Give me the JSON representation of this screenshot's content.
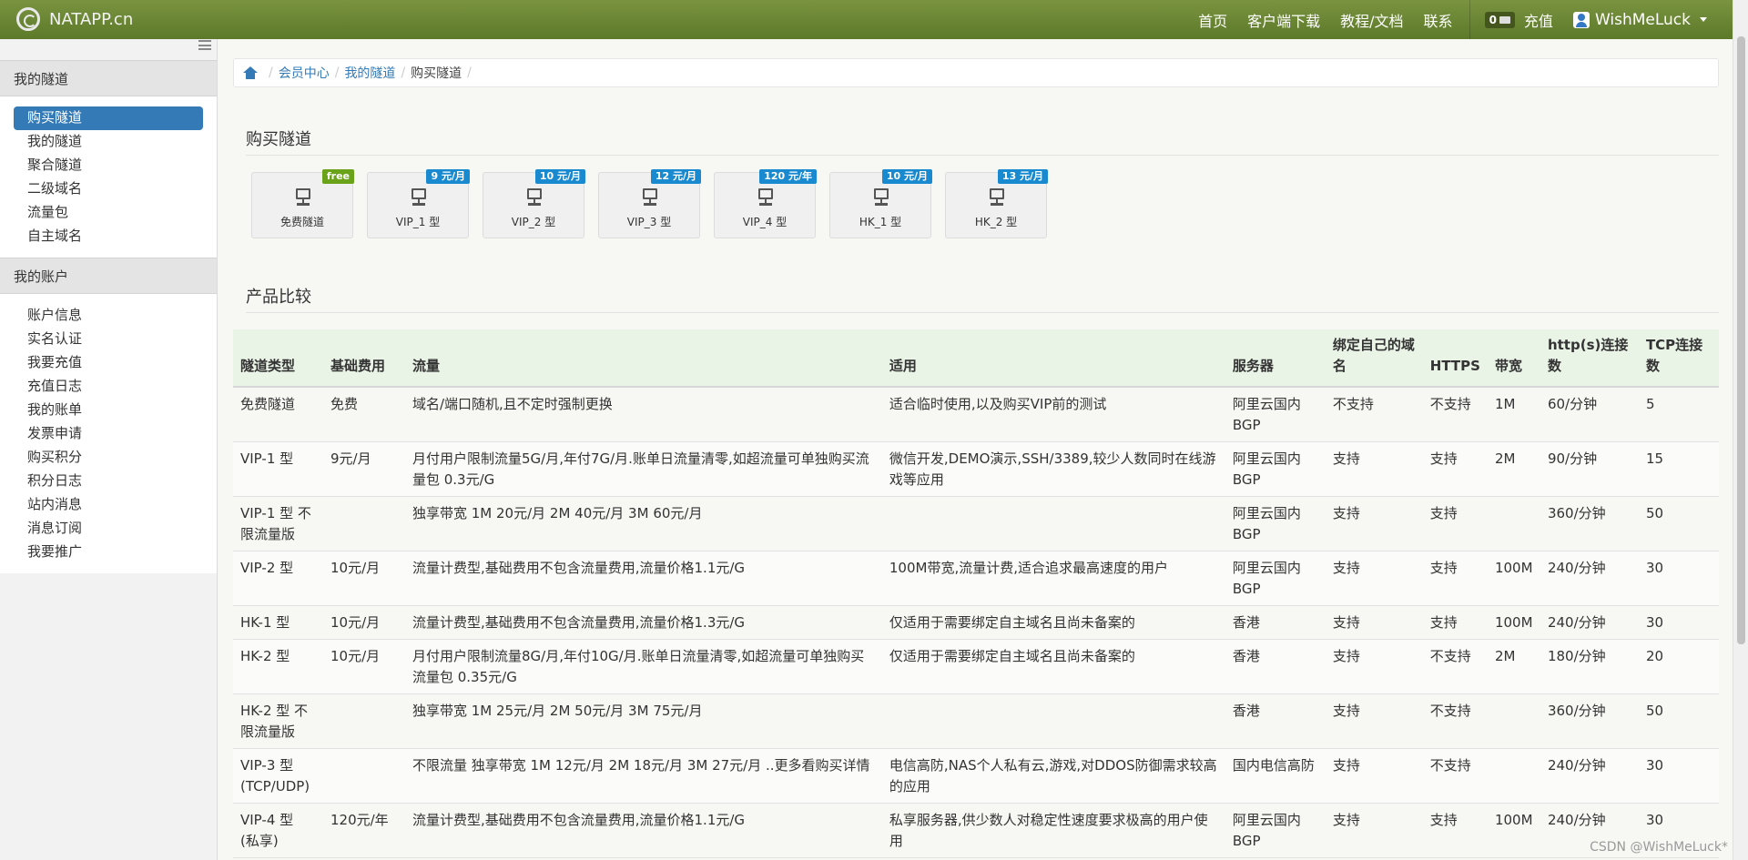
{
  "navbar": {
    "brand": "NATAPP.cn",
    "links": [
      "首页",
      "客户端下载",
      "教程/文档",
      "联系"
    ],
    "msg_count": "0",
    "recharge": "充值",
    "username": "WishMeLuck"
  },
  "sidebar": {
    "section1_title": "我的隧道",
    "section1_items": [
      "购买隧道",
      "我的隧道",
      "聚合隧道",
      "二级域名",
      "流量包",
      "自主域名"
    ],
    "section2_title": "我的账户",
    "section2_items": [
      "账户信息",
      "实名认证",
      "我要充值",
      "充值日志",
      "我的账单",
      "发票申请",
      "购买积分",
      "积分日志",
      "站内消息",
      "消息订阅",
      "我要推广"
    ]
  },
  "breadcrumb": {
    "link1": "会员中心",
    "link2": "我的隧道",
    "current": "购买隧道"
  },
  "buy_title": "购买隧道",
  "compare_title": "产品比较",
  "tiles": [
    {
      "label": "免费隧道",
      "badge": "free"
    },
    {
      "label": "VIP_1 型",
      "badge": "9 元/月"
    },
    {
      "label": "VIP_2 型",
      "badge": "10 元/月"
    },
    {
      "label": "VIP_3 型",
      "badge": "12 元/月"
    },
    {
      "label": "VIP_4 型",
      "badge": "120 元/年"
    },
    {
      "label": "HK_1 型",
      "badge": "10 元/月"
    },
    {
      "label": "HK_2 型",
      "badge": "13 元/月"
    }
  ],
  "table": {
    "headers": [
      "隧道类型",
      "基础费用",
      "流量",
      "适用",
      "服务器",
      "绑定自己的域名",
      "HTTPS",
      "带宽",
      "http(s)连接数",
      "TCP连接数"
    ],
    "rows": [
      [
        "免费隧道",
        "免费",
        "域名/端口随机,且不定时强制更换",
        "适合临时使用,以及购买VIP前的测试",
        "阿里云国内BGP",
        "不支持",
        "不支持",
        "1M",
        "60/分钟",
        "5"
      ],
      [
        "VIP-1 型",
        "9元/月",
        "月付用户限制流量5G/月,年付7G/月.账单日流量清零,如超流量可单独购买流量包 0.3元/G",
        "微信开发,DEMO演示,SSH/3389,较少人数同时在线游戏等应用",
        "阿里云国内BGP",
        "支持",
        "支持",
        "2M",
        "90/分钟",
        "15"
      ],
      [
        "VIP-1 型 不限流量版",
        "",
        "独享带宽 1M 20元/月 2M 40元/月 3M 60元/月",
        "",
        "阿里云国内BGP",
        "支持",
        "支持",
        "",
        "360/分钟",
        "50"
      ],
      [
        "VIP-2 型",
        "10元/月",
        "流量计费型,基础费用不包含流量费用,流量价格1.1元/G",
        "100M带宽,流量计费,适合追求最高速度的用户",
        "阿里云国内BGP",
        "支持",
        "支持",
        "100M",
        "240/分钟",
        "30"
      ],
      [
        "HK-1 型",
        "10元/月",
        "流量计费型,基础费用不包含流量费用,流量价格1.3元/G",
        "仅适用于需要绑定自主域名且尚未备案的",
        "香港",
        "支持",
        "支持",
        "100M",
        "240/分钟",
        "30"
      ],
      [
        "HK-2 型",
        "10元/月",
        "月付用户限制流量8G/月,年付10G/月.账单日流量清零,如超流量可单独购买流量包 0.35元/G",
        "仅适用于需要绑定自主域名且尚未备案的",
        "香港",
        "支持",
        "不支持",
        "2M",
        "180/分钟",
        "20"
      ],
      [
        "HK-2 型 不限流量版",
        "",
        "独享带宽 1M 25元/月 2M 50元/月 3M 75元/月",
        "",
        "香港",
        "支持",
        "不支持",
        "",
        "360/分钟",
        "50"
      ],
      [
        "VIP-3 型 (TCP/UDP)",
        "",
        "不限流量 独享带宽 1M 12元/月 2M 18元/月 3M 27元/月 ..更多看购买详情",
        "电信高防,NAS个人私有云,游戏,对DDOS防御需求较高的应用",
        "国内电信高防",
        "支持",
        "不支持",
        "",
        "240/分钟",
        "30"
      ],
      [
        "VIP-4 型 (私享)",
        "120元/年",
        "流量计费型,基础费用不包含流量费用,流量价格1.1元/G",
        "私享服务器,供少数人对稳定性速度要求极高的用户使用",
        "阿里云国内BGP",
        "支持",
        "支持",
        "100M",
        "240/分钟",
        "30"
      ]
    ]
  },
  "watermark": "CSDN @WishMeLuck*"
}
